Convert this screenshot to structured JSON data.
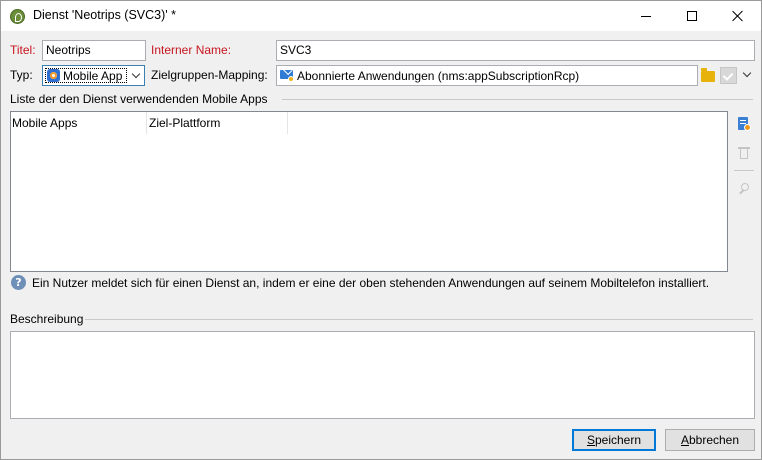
{
  "window": {
    "title": "Dienst 'Neotrips (SVC3)' *",
    "icon": "app-logo-icon",
    "controls": [
      "minimize-icon",
      "maximize-icon",
      "close-icon"
    ]
  },
  "form": {
    "title_label": "Titel:",
    "title_value": "Neotrips",
    "internal_name_label": "Interner Name:",
    "internal_name_value": "SVC3",
    "type_label": "Typ:",
    "type_value": "Mobile App",
    "mapping_label": "Zielgruppen-Mapping:",
    "mapping_value": "Abonnierte Anwendungen (nms:appSubscriptionRcp)"
  },
  "apps_section": {
    "heading": "Liste der den Dienst verwendenden Mobile Apps",
    "columns": [
      "Mobile Apps",
      "Ziel-Plattform"
    ],
    "rows": [],
    "toolbar_icons": [
      "new-icon",
      "delete-icon",
      "detail-search-icon"
    ]
  },
  "help": {
    "text": "Ein Nutzer meldet sich für einen Dienst an, indem er eine der oben stehenden Anwendungen auf seinem Mobiltelefon installiert."
  },
  "description": {
    "heading": "Beschreibung",
    "value": ""
  },
  "buttons": {
    "save_prefix": "",
    "save_mnemonic": "S",
    "save_rest": "peichern",
    "cancel_mnemonic": "A",
    "cancel_rest": "bbrechen"
  },
  "colors": {
    "required_label": "#c8141e",
    "default_button_border": "#0078d7",
    "window_background": "#f0f0f0"
  }
}
